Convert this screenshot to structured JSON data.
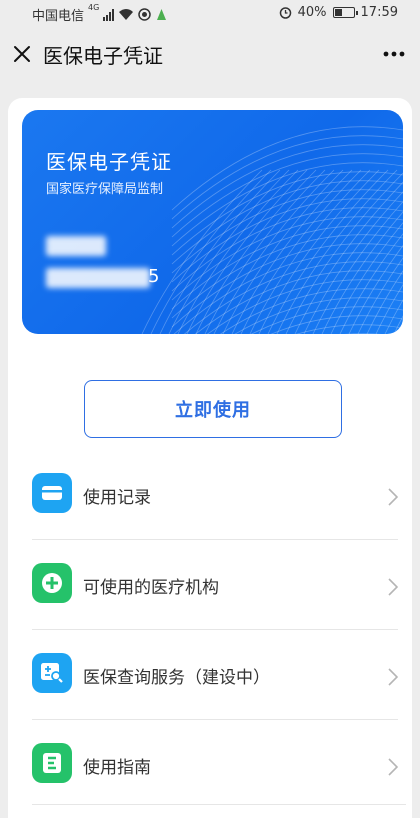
{
  "status_bar": {
    "carrier": "中国电信",
    "network": "4G",
    "battery": "40%",
    "battery_level": 0.4,
    "time": "17:59"
  },
  "nav": {
    "title": "医保电子凭证",
    "close_icon": "close-icon",
    "more_icon": "more-icon"
  },
  "card": {
    "title": "医保电子凭证",
    "subtitle": "国家医疗保障局监制",
    "id_tail": "5",
    "colors": {
      "gradient_start": "#1b78f0",
      "gradient_end": "#1c80f5"
    }
  },
  "use_button": {
    "label": "立即使用",
    "color": "#2f6fe3"
  },
  "menu": {
    "items": [
      {
        "label": "使用记录",
        "icon": "card-icon",
        "color": "#1ea4f2"
      },
      {
        "label": "可使用的医疗机构",
        "icon": "plus-circle-icon",
        "color": "#25c26a"
      },
      {
        "label": "医保查询服务（建设中）",
        "icon": "query-icon",
        "color": "#1ea4f2"
      },
      {
        "label": "使用指南",
        "icon": "guide-icon",
        "color": "#25c26a"
      }
    ]
  }
}
